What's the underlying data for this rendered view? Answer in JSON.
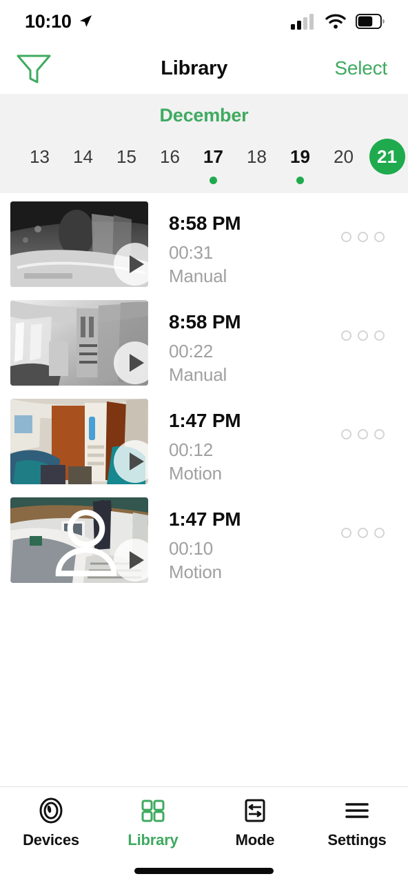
{
  "status_bar": {
    "time": "10:10",
    "location_icon": "location-arrow-icon",
    "cellular_icon": "cellular-signal-icon",
    "wifi_icon": "wifi-icon",
    "battery_icon": "battery-icon",
    "signal_bars_filled": 2,
    "signal_bars_total": 4,
    "battery_level_pct": 62
  },
  "nav": {
    "filter_icon": "filter-funnel-icon",
    "title": "Library",
    "select_label": "Select"
  },
  "date_strip": {
    "month": "December",
    "days": [
      {
        "num": "13",
        "has_events": false,
        "selected": false
      },
      {
        "num": "14",
        "has_events": false,
        "selected": false
      },
      {
        "num": "15",
        "has_events": false,
        "selected": false
      },
      {
        "num": "16",
        "has_events": false,
        "selected": false
      },
      {
        "num": "17",
        "has_events": true,
        "selected": false
      },
      {
        "num": "18",
        "has_events": false,
        "selected": false
      },
      {
        "num": "19",
        "has_events": true,
        "selected": false
      },
      {
        "num": "20",
        "has_events": false,
        "selected": false
      },
      {
        "num": "21",
        "has_events": false,
        "selected": true
      }
    ]
  },
  "clips": [
    {
      "time": "8:58 PM",
      "duration": "00:31",
      "trigger": "Manual",
      "thumb_style": "night-grayscale-cabin",
      "person_detected": false,
      "play_icon": "play-icon",
      "more_icon": "more-options-icon"
    },
    {
      "time": "8:58 PM",
      "duration": "00:22",
      "trigger": "Manual",
      "thumb_style": "night-grayscale-corridor",
      "person_detected": false,
      "play_icon": "play-icon",
      "more_icon": "more-options-icon"
    },
    {
      "time": "1:47 PM",
      "duration": "00:12",
      "trigger": "Motion",
      "thumb_style": "day-color-wood-cabin",
      "person_detected": false,
      "play_icon": "play-icon",
      "more_icon": "more-options-icon"
    },
    {
      "time": "1:47 PM",
      "duration": "00:10",
      "trigger": "Motion",
      "thumb_style": "day-color-deck-person",
      "person_detected": true,
      "play_icon": "play-icon",
      "more_icon": "more-options-icon"
    }
  ],
  "tabs": [
    {
      "label": "Devices",
      "icon": "camera-lens-icon",
      "active": false
    },
    {
      "label": "Library",
      "icon": "grid-icon",
      "active": true
    },
    {
      "label": "Mode",
      "icon": "sliders-icon",
      "active": false
    },
    {
      "label": "Settings",
      "icon": "hamburger-icon",
      "active": false
    }
  ],
  "colors": {
    "accent_green": "#3faa60",
    "selected_green": "#1faa4e",
    "strip_background": "#f2f2f2",
    "primary_text": "#0d0d0d",
    "secondary_text": "#a0a0a0"
  }
}
